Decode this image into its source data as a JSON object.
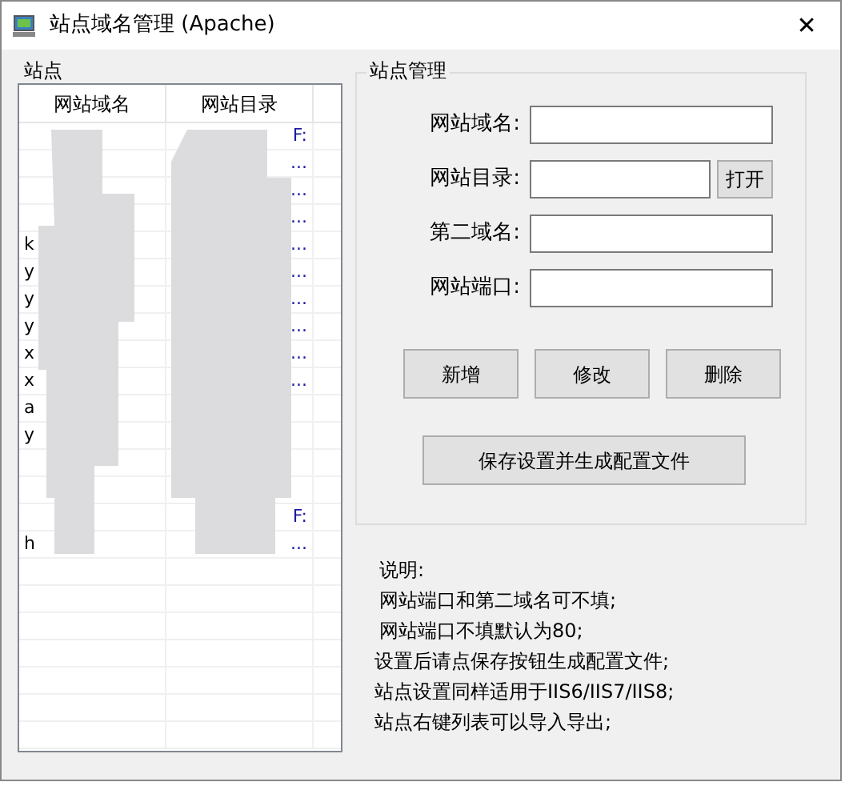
{
  "window": {
    "title": "站点域名管理 (Apache)",
    "close": "✕"
  },
  "sites": {
    "title": "站点",
    "columns": [
      "网站域名",
      "网站目录"
    ],
    "rows": [
      {
        "dir": "F:"
      },
      {
        "dir": "..."
      },
      {
        "dir": "..."
      },
      {
        "dir": "..."
      },
      {
        "domain": "k",
        "dir": "..."
      },
      {
        "domain": "y",
        "dir": "..."
      },
      {
        "domain": "y",
        "dir": "..."
      },
      {
        "domain": "y",
        "dir": "..."
      },
      {
        "domain": "x",
        "dir": "..."
      },
      {
        "domain": "x",
        "dir": "..."
      },
      {
        "domain": "a"
      },
      {
        "domain": "y"
      },
      {},
      {},
      {
        "dir": "F:"
      },
      {
        "domain": "h",
        "dir": "..."
      },
      {},
      {},
      {},
      {},
      {},
      {},
      {}
    ]
  },
  "manage": {
    "title": "站点管理",
    "fields": [
      {
        "label": "网站域名:"
      },
      {
        "label": "网站目录:",
        "button": "打开"
      },
      {
        "label": "第二域名:"
      },
      {
        "label": "网站端口:"
      }
    ],
    "buttons": [
      "新增",
      "修改",
      "删除"
    ],
    "save": "保存设置并生成配置文件"
  },
  "notes": [
    "说明:",
    "网站端口和第二域名可不填;",
    "网站端口不填默认为80;",
    "设置后请点保存按钮生成配置文件;",
    "站点设置同样适用于IIS6/IIS7/IIS8;",
    "站点右键列表可以导入导出;"
  ]
}
